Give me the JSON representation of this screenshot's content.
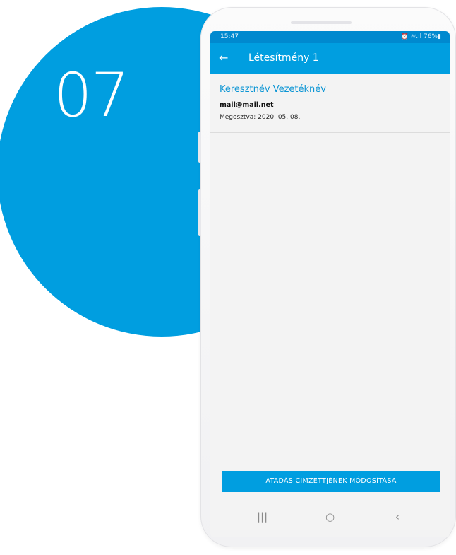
{
  "step_number": "07",
  "status_bar": {
    "time": "15:47",
    "icons": "⏰ ≋.ıl 76%▮",
    "battery": "76%"
  },
  "app_bar": {
    "back_icon": "←",
    "title": "Létesítmény 1"
  },
  "share_item": {
    "name": "Keresztnév Vezetéknév",
    "email": "mail@mail.net",
    "shared_label": "Megosztva: 2020. 05. 08."
  },
  "action_button": "ÁTADÁS CÍMZETTJÉNEK MÓDOSÍTÁSA",
  "nav_bar": {
    "recents": "|||",
    "home": "○",
    "back": "‹"
  },
  "colors": {
    "accent": "#009ee0",
    "status_bar": "#0089cf",
    "name_text": "#0b95d4"
  }
}
